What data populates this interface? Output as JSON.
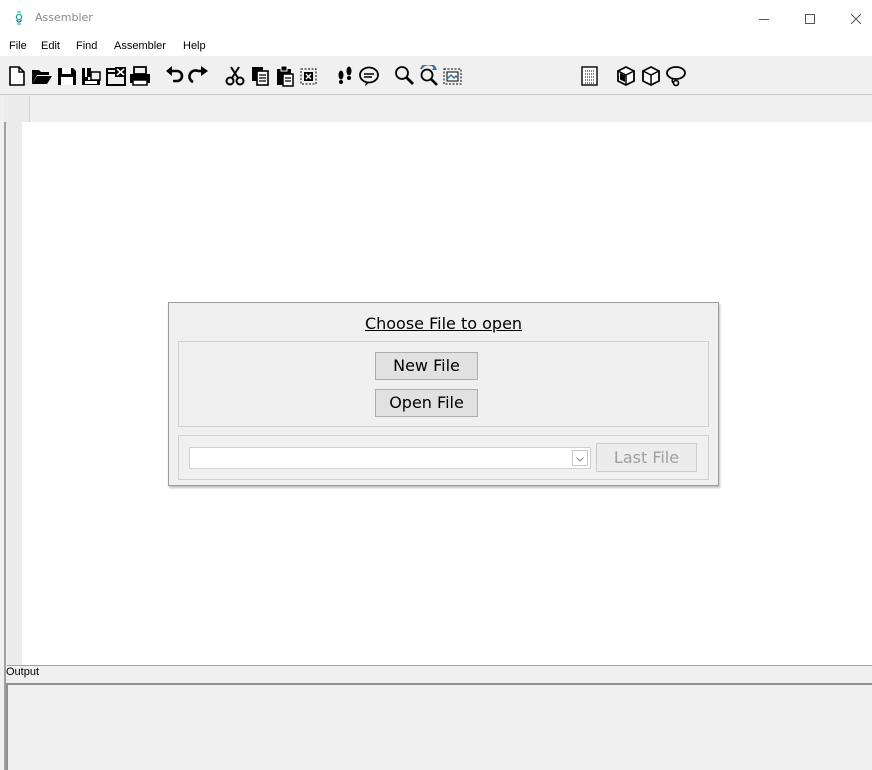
{
  "window": {
    "title": "Assembler"
  },
  "menu": {
    "items": [
      "File",
      "Edit",
      "Find",
      "Assembler",
      "Help"
    ]
  },
  "toolbar": {
    "icons": [
      "new-file-icon",
      "open-folder-icon",
      "save-icon",
      "save-as-icon",
      "close-file-icon",
      "print-icon",
      "undo-icon",
      "redo-icon",
      "cut-icon",
      "copy-icon",
      "paste-icon",
      "delete-icon",
      "footprints-icon",
      "speech-bubble-icon",
      "search-icon",
      "replace-icon",
      "select-all-icon",
      "grid-icon",
      "box-icon",
      "box-outline-icon",
      "lasso-icon"
    ]
  },
  "output": {
    "label": "Output"
  },
  "dialog": {
    "title": "Choose File to open",
    "new_file_label": "New File",
    "open_file_label": "Open File",
    "recent_value": "",
    "last_file_label": "Last File"
  },
  "colors": {
    "accent_teal": "#1ea59a",
    "accent_blue": "#2b6ea8"
  }
}
